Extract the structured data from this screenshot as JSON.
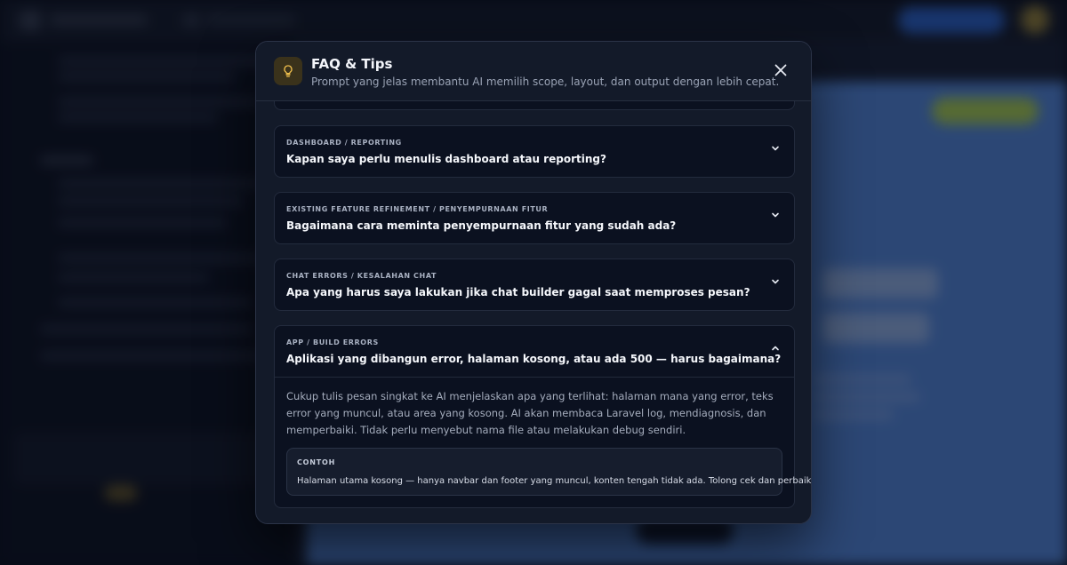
{
  "modal": {
    "title": "FAQ & Tips",
    "subtitle": "Prompt yang jelas membantu AI memilih scope, layout, dan output dengan lebih cepat.",
    "icon": "lightbulb-icon",
    "close_icon": "close-icon"
  },
  "faq": [
    {
      "category": "DASHBOARD / REPORTING",
      "question": "Kapan saya perlu menulis dashboard atau reporting?",
      "expanded": false
    },
    {
      "category": "EXISTING FEATURE REFINEMENT / PENYEMPURNAAN FITUR",
      "question": "Bagaimana cara meminta penyempurnaan fitur yang sudah ada?",
      "expanded": false
    },
    {
      "category": "CHAT ERRORS / KESALAHAN CHAT",
      "question": "Apa yang harus saya lakukan jika chat builder gagal saat memproses pesan?",
      "expanded": false
    },
    {
      "category": "APP / BUILD ERRORS",
      "question": "Aplikasi yang dibangun error, halaman kosong, atau ada 500 — harus bagaimana?",
      "expanded": true,
      "answer": "Cukup tulis pesan singkat ke AI menjelaskan apa yang terlihat: halaman mana yang error, teks error yang muncul, atau area yang kosong. AI akan membaca Laravel log, mendiagnosis, dan memperbaiki. Tidak perlu menyebut nama file atau melakukan debug sendiri.",
      "example_label": "CONTOH",
      "example_text": "Halaman utama kosong — hanya navbar dan footer yang muncul, konten tengah tidak ada. Tolong cek dan perbaiki."
    }
  ],
  "colors": {
    "icon_accent": "#f2c14e",
    "preview_bg": "#5b93ec",
    "modal_bg": "#131a29"
  }
}
